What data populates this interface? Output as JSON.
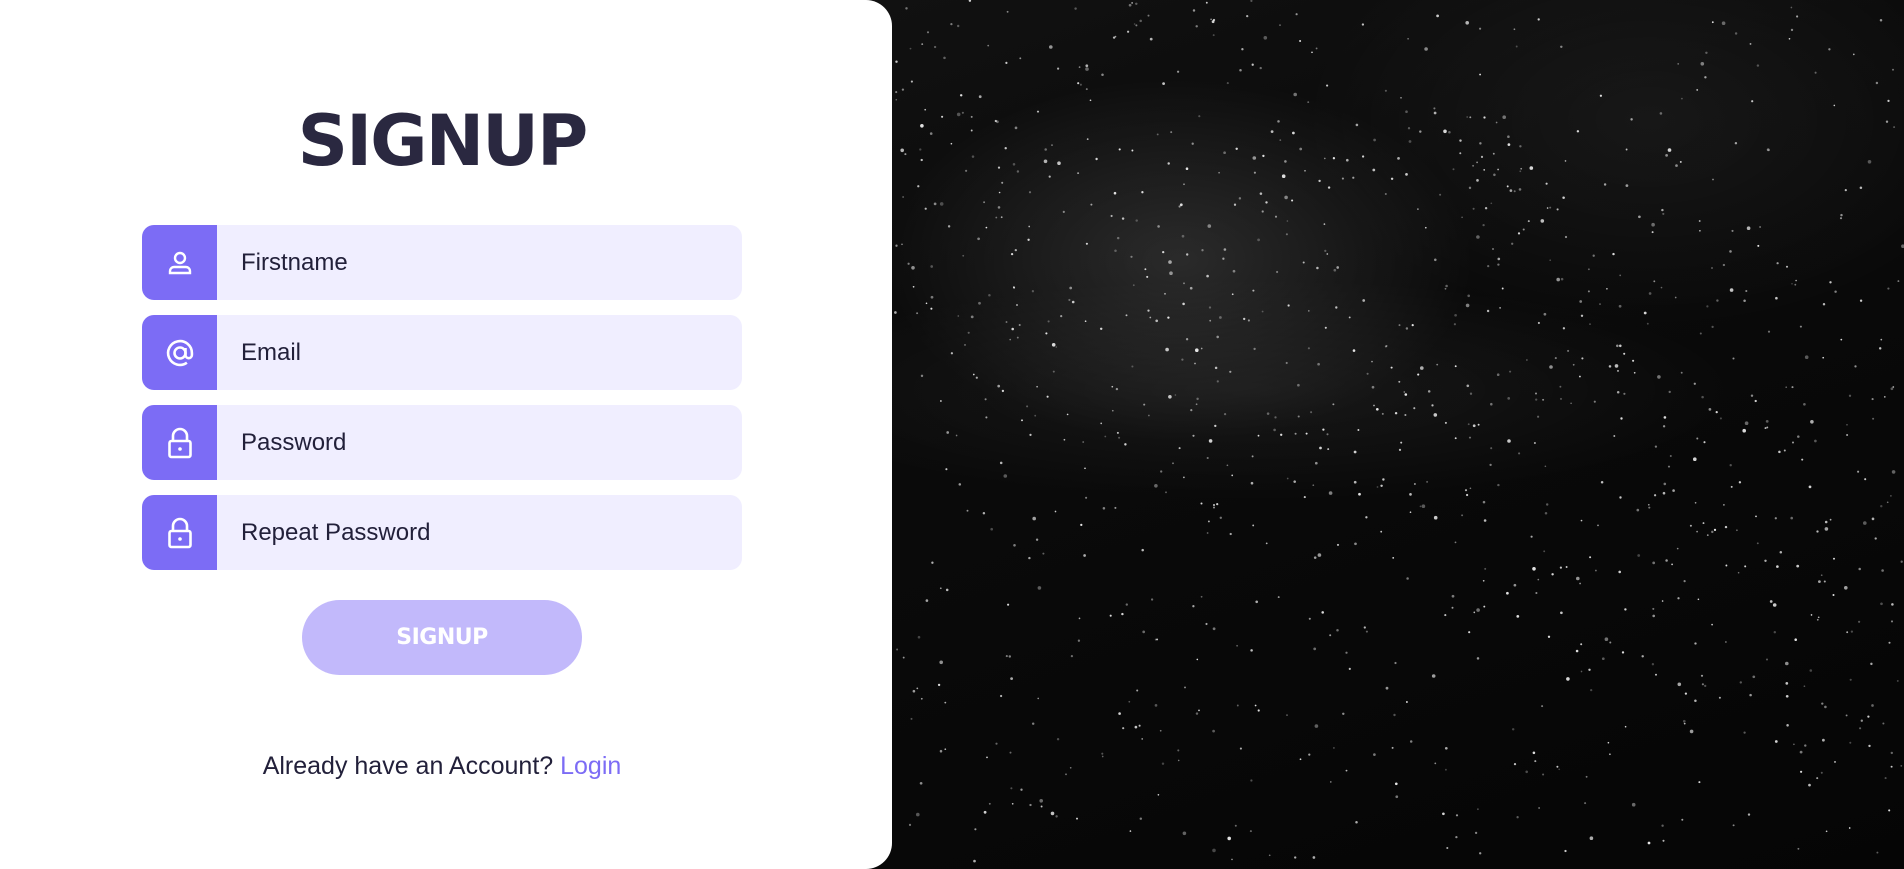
{
  "form": {
    "title": "SIGNUP",
    "fields": [
      {
        "placeholder": "Firstname",
        "value": "",
        "icon": "user-icon"
      },
      {
        "placeholder": "Email",
        "value": "",
        "icon": "at-sign-icon"
      },
      {
        "placeholder": "Password",
        "value": "",
        "icon": "lock-icon"
      },
      {
        "placeholder": "Repeat Password",
        "value": "",
        "icon": "lock-icon"
      }
    ],
    "submit_label": "SIGNUP"
  },
  "footer": {
    "prompt": "Already have an Account?",
    "login_label": "Login"
  },
  "colors": {
    "accent": "#7c6cf5",
    "field_bg": "#f0eeff",
    "button_bg": "#c2b9fb",
    "title": "#2a2840",
    "panel_bg": "#ffffff"
  }
}
